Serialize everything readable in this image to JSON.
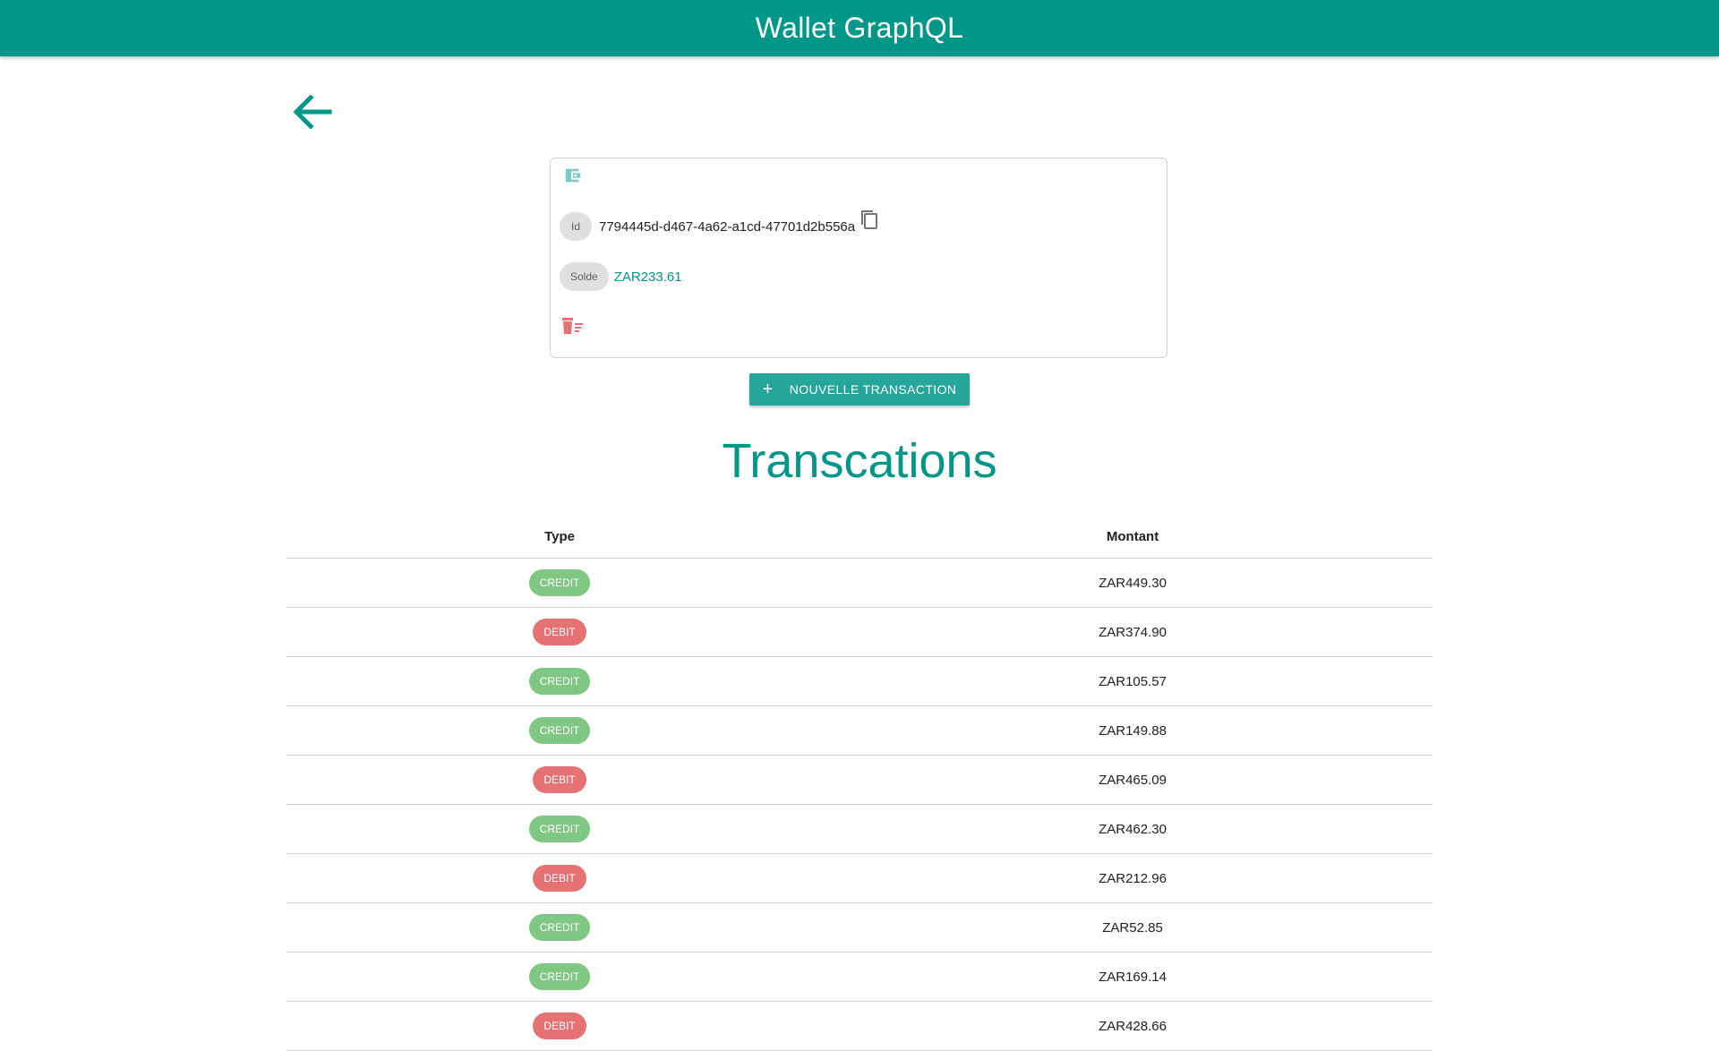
{
  "app": {
    "title": "Wallet GraphQL"
  },
  "icons": {
    "back": "arrow-left-icon",
    "wallet": "wallet-icon",
    "copy": "copy-icon",
    "delete": "delete-sweep-icon",
    "plus": "plus-icon"
  },
  "colors": {
    "primary": "#009688",
    "button": "#26a69a",
    "credit": "#81c784",
    "debit": "#e57373"
  },
  "wallet": {
    "id_label": "Id",
    "id_value": "7794445d-d467-4a62-a1cd-47701d2b556a",
    "solde_label": "Solde",
    "solde_value": "ZAR233.61"
  },
  "actions": {
    "new_transaction_plus": "+",
    "new_transaction_label": "NOUVELLE TRANSACTION"
  },
  "transactions": {
    "title": "Transcations",
    "headers": {
      "type": "Type",
      "amount": "Montant"
    },
    "rows": [
      {
        "type": "CREDIT",
        "amount": "ZAR449.30"
      },
      {
        "type": "DEBIT",
        "amount": "ZAR374.90"
      },
      {
        "type": "CREDIT",
        "amount": "ZAR105.57"
      },
      {
        "type": "CREDIT",
        "amount": "ZAR149.88"
      },
      {
        "type": "DEBIT",
        "amount": "ZAR465.09"
      },
      {
        "type": "CREDIT",
        "amount": "ZAR462.30"
      },
      {
        "type": "DEBIT",
        "amount": "ZAR212.96"
      },
      {
        "type": "CREDIT",
        "amount": "ZAR52.85"
      },
      {
        "type": "CREDIT",
        "amount": "ZAR169.14"
      },
      {
        "type": "DEBIT",
        "amount": "ZAR428.66"
      }
    ]
  }
}
